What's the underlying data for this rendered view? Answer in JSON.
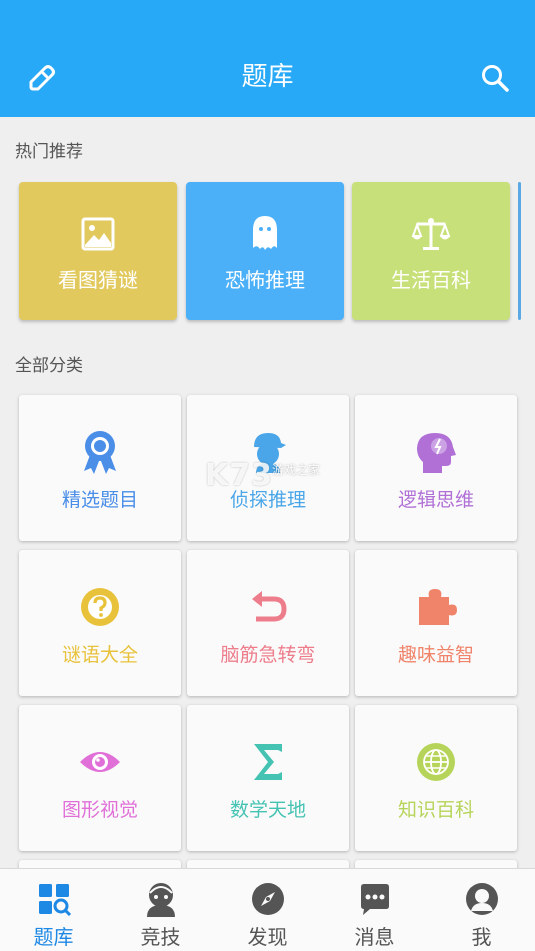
{
  "header": {
    "title": "题库"
  },
  "hot": {
    "label": "热门推荐",
    "cards": [
      {
        "label": "看图猜谜",
        "icon": "image-icon",
        "color": "#e2c95e"
      },
      {
        "label": "恐怖推理",
        "icon": "ghost-icon",
        "color": "#4bb0f8"
      },
      {
        "label": "生活百科",
        "icon": "scale-icon",
        "color": "#c8e07a"
      }
    ]
  },
  "all": {
    "label": "全部分类",
    "cards": [
      {
        "label": "精选题目",
        "icon": "badge-icon",
        "color": "#4a8ee8"
      },
      {
        "label": "侦探推理",
        "icon": "detective-icon",
        "color": "#4aa6e8"
      },
      {
        "label": "逻辑思维",
        "icon": "brain-icon",
        "color": "#b070d6"
      },
      {
        "label": "谜语大全",
        "icon": "question-icon",
        "color": "#e8c23a"
      },
      {
        "label": "脑筋急转弯",
        "icon": "undo-icon",
        "color": "#ee7d8c"
      },
      {
        "label": "趣味益智",
        "icon": "puzzle-icon",
        "color": "#f0846a"
      },
      {
        "label": "图形视觉",
        "icon": "eye-icon",
        "color": "#e070d8"
      },
      {
        "label": "数学天地",
        "icon": "sigma-icon",
        "color": "#45c3b2"
      },
      {
        "label": "知识百科",
        "icon": "globe-icon",
        "color": "#b7d45a"
      }
    ]
  },
  "tabs": [
    {
      "label": "题库",
      "icon": "library-icon",
      "active": true
    },
    {
      "label": "竞技",
      "icon": "compete-icon",
      "active": false
    },
    {
      "label": "发现",
      "icon": "compass-icon",
      "active": false
    },
    {
      "label": "消息",
      "icon": "message-icon",
      "active": false
    },
    {
      "label": "我",
      "icon": "profile-icon",
      "active": false
    }
  ],
  "watermark": {
    "main": "K73",
    "sub": "游戏之家"
  }
}
